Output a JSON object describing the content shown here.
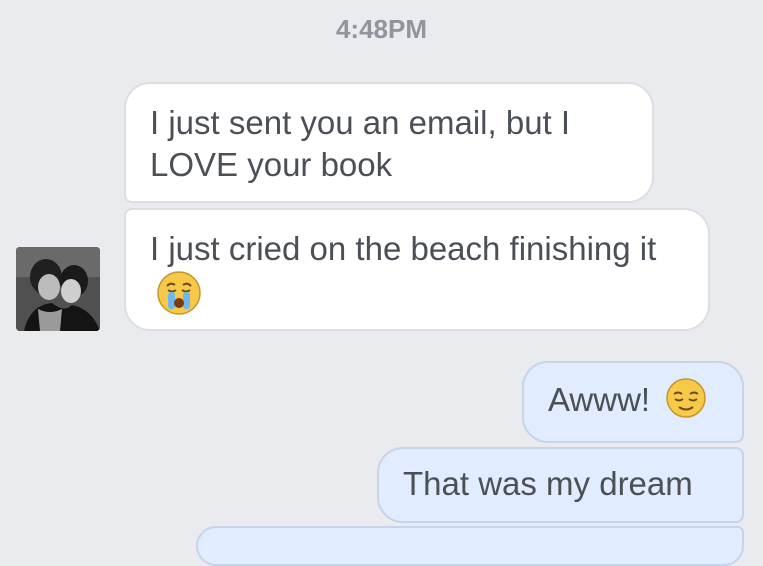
{
  "conversation": {
    "timestamp": "4:48PM",
    "messages": [
      {
        "sender": "other",
        "text": "I just sent you an email, but I LOVE your book"
      },
      {
        "sender": "other",
        "text": "I just cried on the beach finishing it",
        "emoji": "crying-face-icon"
      },
      {
        "sender": "me",
        "text": "Awww!",
        "emoji": "relieved-face-icon"
      },
      {
        "sender": "me",
        "text": "That was my dream"
      }
    ]
  },
  "colors": {
    "background": "#e9ebee",
    "incoming_bubble": "#ffffff",
    "outgoing_bubble": "#e1ecfe",
    "text": "#4b4f56",
    "timestamp": "#90949c"
  }
}
